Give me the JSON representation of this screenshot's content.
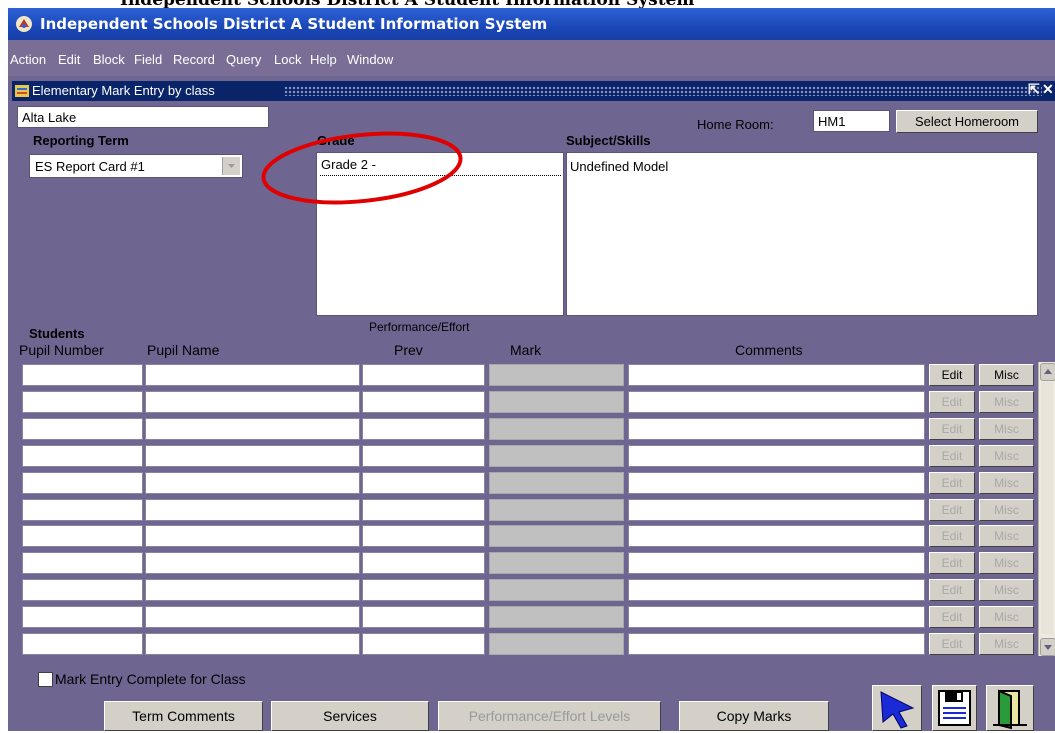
{
  "top_fragment": "Independent Schools District A Student Information System",
  "window": {
    "title": "Independent Schools District A Student Information System"
  },
  "menu": [
    "Action",
    "Edit",
    "Block",
    "Field",
    "Record",
    "Query",
    "Lock",
    "Help",
    "Window"
  ],
  "form": {
    "title": "Elementary Mark Entry by class",
    "school": "Alta Lake",
    "homeroom_label": "Home Room:",
    "homeroom_value": "HM1",
    "select_homeroom_label": "Select Homeroom",
    "reporting_term_label": "Reporting Term",
    "reporting_term_value": "ES Report Card #1",
    "grade_label": "Grade",
    "grade_value": "Grade 2 -",
    "subject_label": "Subject/Skills",
    "subject_value": "Undefined Model"
  },
  "students": {
    "section_label": "Students",
    "performance_label": "Performance/Effort",
    "columns": [
      "Pupil Number",
      "Pupil Name",
      "Prev",
      "Mark",
      "Comments"
    ],
    "edit_label": "Edit",
    "misc_label": "Misc",
    "row_count": 11
  },
  "footer": {
    "complete_label": "Mark Entry Complete for Class",
    "complete_checked": false,
    "buttons": [
      "Term Comments",
      "Services",
      "Performance/Effort Levels",
      "Copy Marks"
    ]
  },
  "icons": [
    "sis-app-icon",
    "form-icon",
    "select-arrow-icon",
    "save-icon",
    "exit-door-icon"
  ],
  "colors": {
    "titlebar": "#1a47b8",
    "form_bg": "#6f6591",
    "form_titlebar": "#0a246a",
    "annotation": "#e00000"
  }
}
